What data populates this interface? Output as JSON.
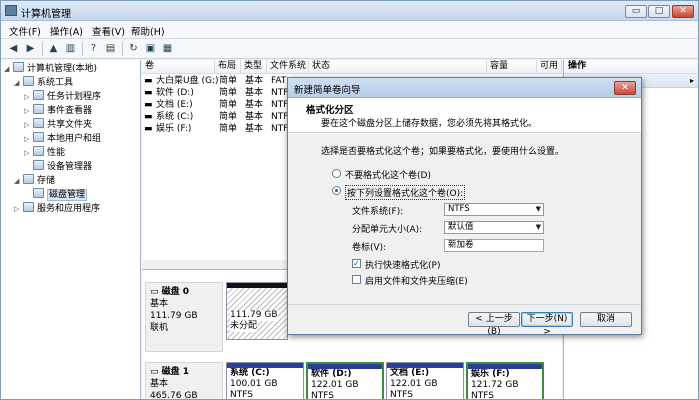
{
  "window": {
    "title": "计算机管理",
    "min": "▭",
    "max": "□",
    "close": "✕"
  },
  "menu": [
    "文件(F)",
    "操作(A)",
    "查看(V)",
    "帮助(H)"
  ],
  "tree": {
    "root": "计算机管理(本地)",
    "items": [
      {
        "label": "系统工具",
        "level": 1,
        "toggle": "◢"
      },
      {
        "label": "任务计划程序",
        "level": 2,
        "toggle": "▷"
      },
      {
        "label": "事件查看器",
        "level": 2,
        "toggle": "▷"
      },
      {
        "label": "共享文件夹",
        "level": 2,
        "toggle": "▷"
      },
      {
        "label": "本地用户和组",
        "level": 2,
        "toggle": "▷"
      },
      {
        "label": "性能",
        "level": 2,
        "toggle": "▷"
      },
      {
        "label": "设备管理器",
        "level": 2,
        "toggle": ""
      },
      {
        "label": "存储",
        "level": 1,
        "toggle": "◢"
      },
      {
        "label": "磁盘管理",
        "level": 2,
        "toggle": ""
      },
      {
        "label": "服务和应用程序",
        "level": 1,
        "toggle": "▷"
      }
    ]
  },
  "columns": [
    "卷",
    "布局",
    "类型",
    "文件系统",
    "状态",
    "容量",
    "可用",
    "操作"
  ],
  "volumes": [
    {
      "name": "大白菜U盘 (G:)",
      "layout": "简单",
      "type": "基本",
      "fs": "FAT"
    },
    {
      "name": "软件 (D:)",
      "layout": "简单",
      "type": "基本",
      "fs": "NTF"
    },
    {
      "name": "文档 (E:)",
      "layout": "简单",
      "type": "基本",
      "fs": "NTF"
    },
    {
      "name": "系统 (C:)",
      "layout": "简单",
      "type": "基本",
      "fs": "NTF"
    },
    {
      "name": "娱乐 (F:)",
      "layout": "简单",
      "type": "基本",
      "fs": "NTF"
    }
  ],
  "actions": {
    "header": "操作",
    "scroll": "▸"
  },
  "disks": [
    {
      "name": "磁盘 0",
      "type": "基本",
      "size": "111.79 GB",
      "status": "联机"
    },
    {
      "name": "磁盘 1",
      "type": "基本",
      "size": "465.76 GB"
    }
  ],
  "disk0_part": {
    "size": "111.79 GB",
    "status": "未分配"
  },
  "disk1_parts": [
    {
      "label": "系统 (C:)",
      "size": "100.01 GB NTFS"
    },
    {
      "label": "软件 (D:)",
      "size": "122.01 GB NTFS"
    },
    {
      "label": "文档 (E:)",
      "size": "122.01 GB NTFS"
    },
    {
      "label": "娱乐 (F:)",
      "size": "121.72 GB NTFS"
    }
  ],
  "dialog": {
    "title": "新建简单卷向导",
    "close": "✕",
    "heading": "格式化分区",
    "subheading": "要在这个磁盘分区上储存数据，您必须先将其格式化。",
    "prompt": "选择是否要格式化这个卷；如果要格式化，要使用什么设置。",
    "opt_no_format": "不要格式化这个卷(D)",
    "opt_format": "按下列设置格式化这个卷(O):",
    "fs_label": "文件系统(F):",
    "fs_value": "NTFS",
    "alloc_label": "分配单元大小(A):",
    "alloc_value": "默认值",
    "vol_label": "卷标(V):",
    "vol_value": "新加卷",
    "quick_format": "执行快速格式化(P)",
    "compress": "启用文件和文件夹压缩(E)",
    "back": "< 上一步(B)",
    "next": "下一步(N) >",
    "cancel": "取消"
  },
  "colors": {
    "primary_partition": "#2a3e9e",
    "unallocated": "#111111",
    "selection": "#d9e6f7"
  }
}
